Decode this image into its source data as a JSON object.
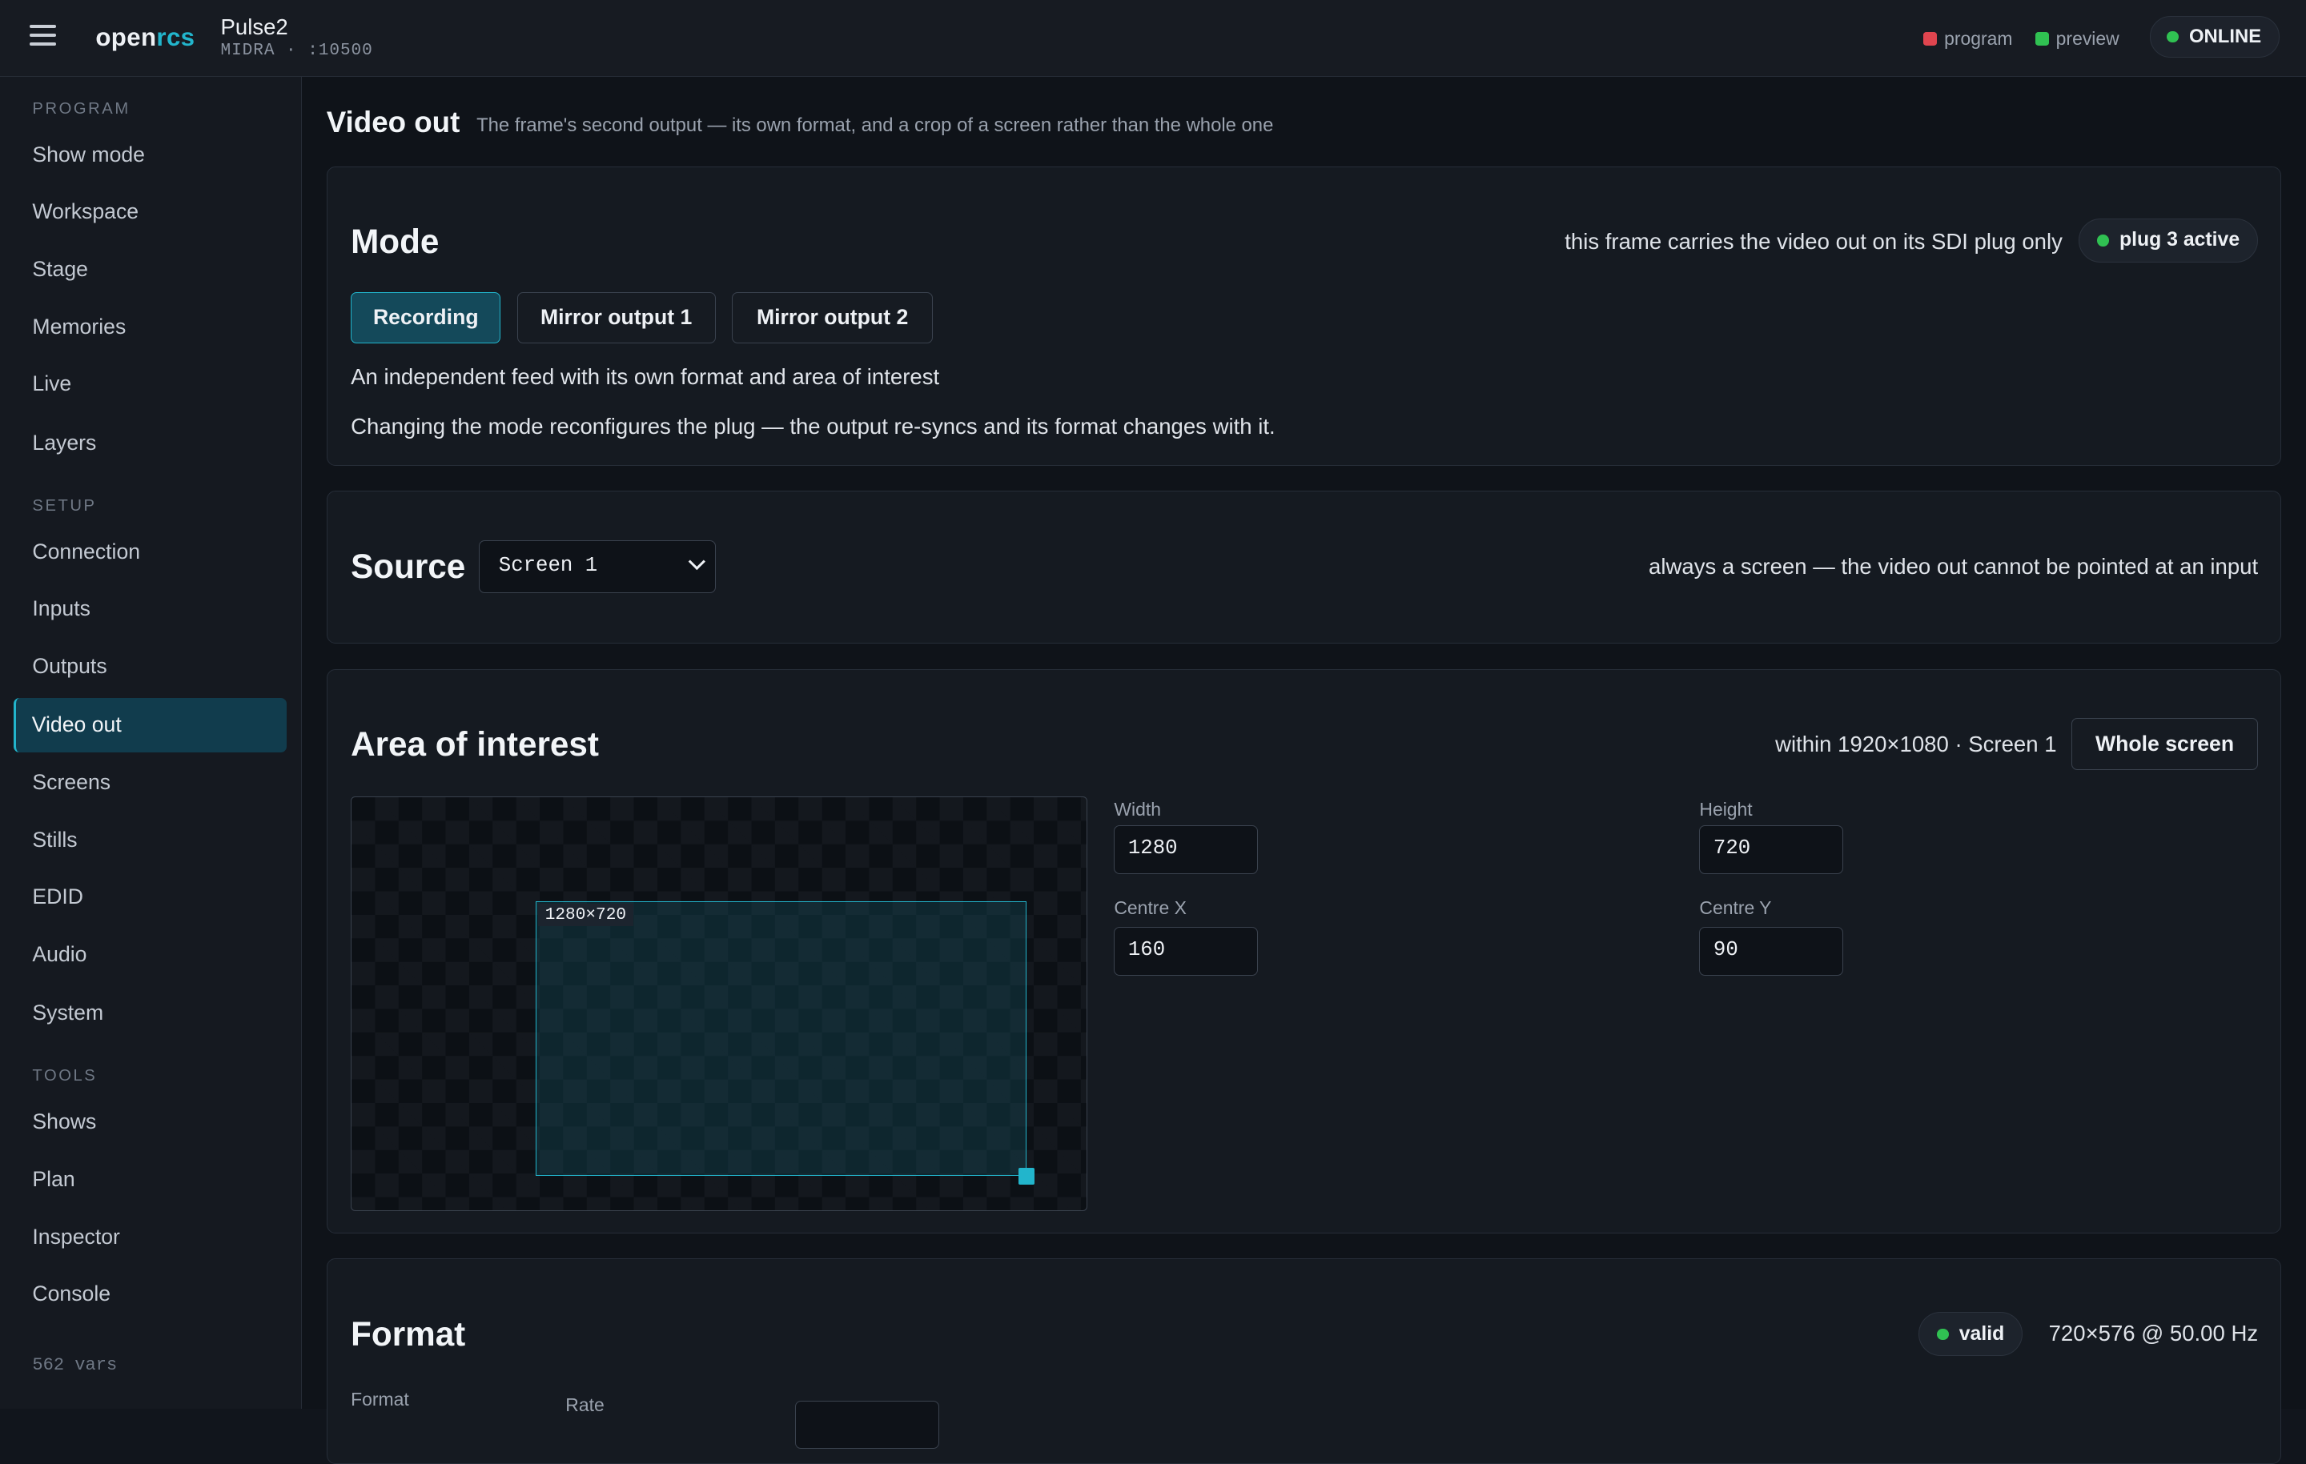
{
  "header": {
    "logo_a": "open",
    "logo_b": "rcs",
    "title": "Pulse2",
    "subtitle": "MIDRA · :10500",
    "legend_program": "program",
    "legend_preview": "preview",
    "status": "ONLINE",
    "colors": {
      "program": "#e0454f",
      "preview": "#30c152",
      "accent": "#22b5cc"
    }
  },
  "sidebar": {
    "sections": [
      {
        "label": "PROGRAM",
        "items": [
          "Show mode",
          "Workspace",
          "Stage",
          "Memories",
          "Live",
          "Layers"
        ]
      },
      {
        "label": "SETUP",
        "items": [
          "Connection",
          "Inputs",
          "Outputs",
          "Video out",
          "Screens",
          "Stills",
          "EDID",
          "Audio",
          "System"
        ]
      },
      {
        "label": "TOOLS",
        "items": [
          "Shows",
          "Plan",
          "Inspector",
          "Console"
        ]
      }
    ],
    "active": "Video out",
    "footer": "562 vars"
  },
  "page": {
    "title": "Video out",
    "description": "The frame's second output — its own format, and a crop of a screen rather than the whole one"
  },
  "mode": {
    "title": "Mode",
    "note": "this frame carries the video out on its SDI plug only",
    "badge": "plug 3 active",
    "buttons": [
      "Recording",
      "Mirror output 1",
      "Mirror output 2"
    ],
    "selected": "Recording",
    "line1": "An independent feed with its own format and area of interest",
    "line2": "Changing the mode reconfigures the plug — the output re-syncs and its format changes with it."
  },
  "source": {
    "title": "Source",
    "selected": "Screen 1",
    "note": "always a screen — the video out cannot be pointed at an input"
  },
  "aoi": {
    "title": "Area of interest",
    "note": "within 1920×1080 · Screen 1",
    "whole_screen_button": "Whole screen",
    "crop_label": "1280×720",
    "width_label": "Width",
    "width_value": "1280",
    "height_label": "Height",
    "height_value": "720",
    "cx_label": "Centre X",
    "cx_value": "160",
    "cy_label": "Centre Y",
    "cy_value": "90"
  },
  "format": {
    "title": "Format",
    "badge": "valid",
    "summary": "720×576 @ 50.00 Hz",
    "format_label": "Format",
    "rate_label": "Rate"
  }
}
